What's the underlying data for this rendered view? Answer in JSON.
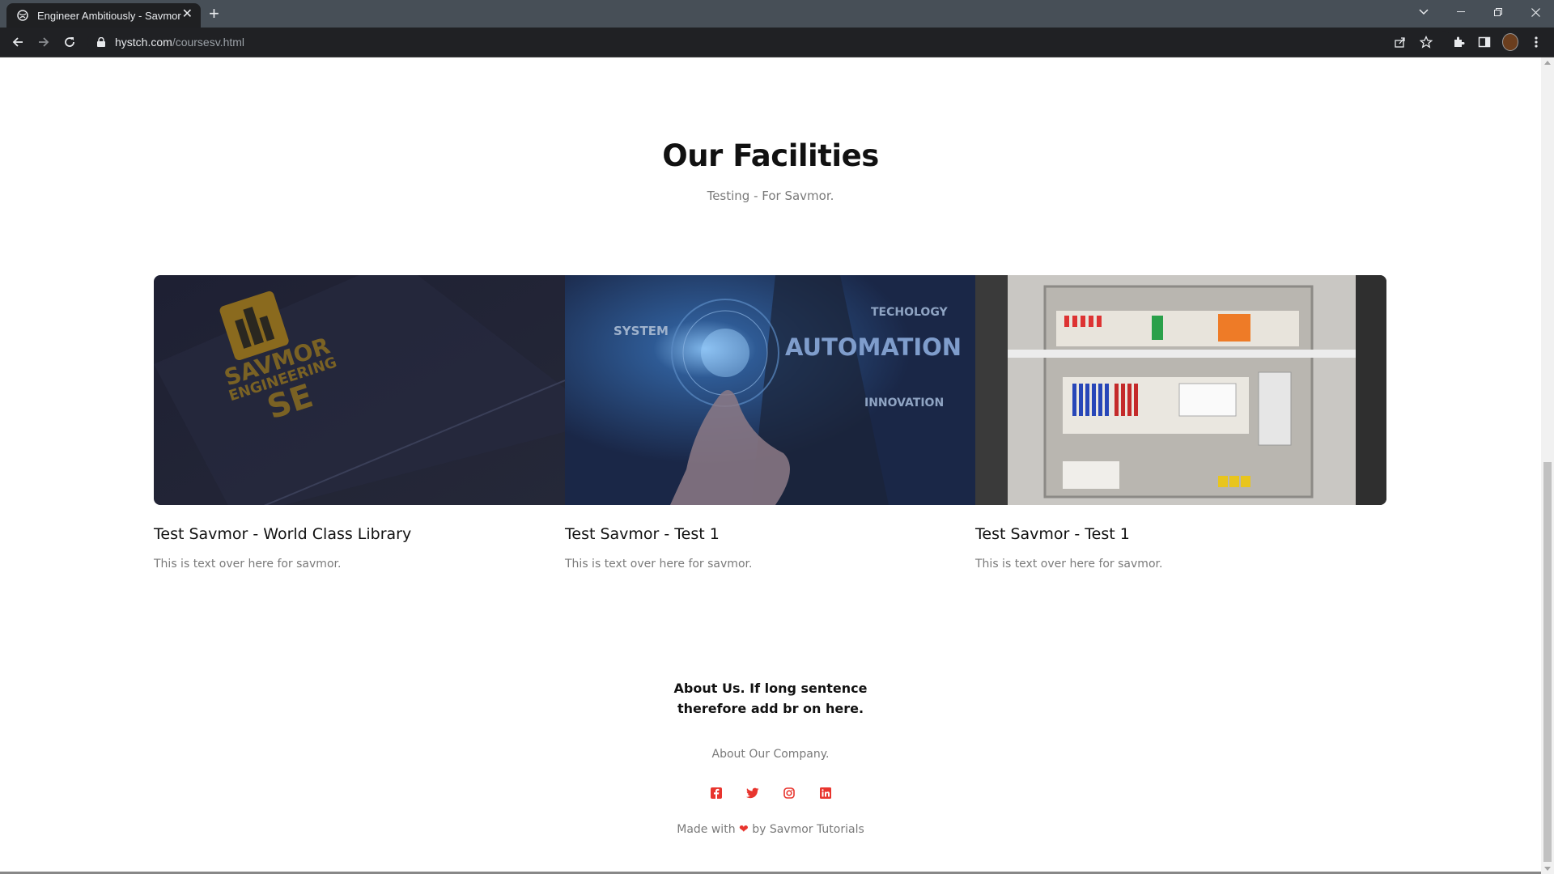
{
  "browser": {
    "tab_title": "Engineer Ambitiously - Savmor",
    "tab_close": "✕",
    "new_tab": "+",
    "url_host": "hystch.com",
    "url_path": "/coursesv.html"
  },
  "page": {
    "heading": "Our Facilities",
    "subheading": "Testing - For Savmor.",
    "cards": [
      {
        "title": "Test Savmor - World Class Library",
        "text": "This is text over here for savmor.",
        "image_logo_line1": "SAVMOR",
        "image_logo_line2": "ENGINEERING",
        "image_logo_line3": "SE"
      },
      {
        "title": "Test Savmor - Test 1",
        "text": "This is text over here for savmor.",
        "image_word_system": "SYSTEM",
        "image_word_techology": "TECHOLOGY",
        "image_word_automation": "AUTOMATION",
        "image_word_innovation": "INNOVATION"
      },
      {
        "title": "Test Savmor - Test 1",
        "text": "This is text over here for savmor."
      }
    ],
    "about_title_line1": "About Us. If long sentence",
    "about_title_line2": "therefore add br on here.",
    "about_sub": "About Our Company.",
    "made_prefix": "Made with",
    "made_suffix": "by Savmor Tutorials",
    "heart": "❤",
    "socials": [
      "facebook-icon",
      "twitter-icon",
      "instagram-icon",
      "linkedin-icon"
    ],
    "accent_color": "#e8352e"
  }
}
